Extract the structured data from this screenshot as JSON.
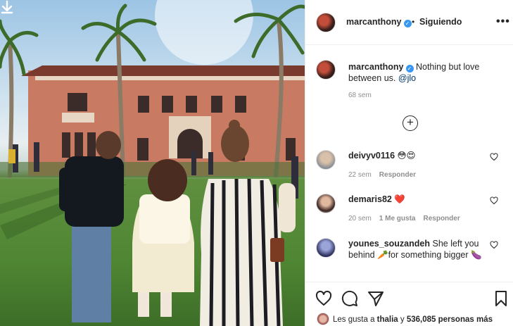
{
  "post": {
    "author": "marcanthony",
    "separator": "•",
    "follow_state": "Siguiendo",
    "more": "•••"
  },
  "caption": {
    "username": "marcanthony",
    "text": "Nothing but love between us.",
    "mention": "@jlo",
    "time": "68 sem"
  },
  "load_more": "+",
  "comments": [
    {
      "username": "deivyv0116",
      "text": "😳😍",
      "time": "22 sem",
      "likes": "",
      "reply": "Responder"
    },
    {
      "username": "demaris82",
      "text": "❤️",
      "time": "20 sem",
      "likes": "1 Me gusta",
      "reply": "Responder"
    },
    {
      "username": "younes_souzandeh",
      "text": "She left you behind 🥕for something bigger 🍆",
      "time": "",
      "likes": "",
      "reply": ""
    }
  ],
  "likes_line": {
    "prefix": "Les gusta a",
    "user": "thalia",
    "connector": "y",
    "count": "536,085 personas más"
  },
  "icons": {
    "download": "download-arrow-icon",
    "verified": "verified-badge-icon",
    "like": "heart-outline-icon",
    "comment": "comment-bubble-icon",
    "share": "paper-plane-icon",
    "save": "bookmark-icon"
  },
  "colors": {
    "verified": "#3897f0",
    "mention": "#00376b",
    "muted": "#8e8e8e",
    "text": "#262626"
  }
}
